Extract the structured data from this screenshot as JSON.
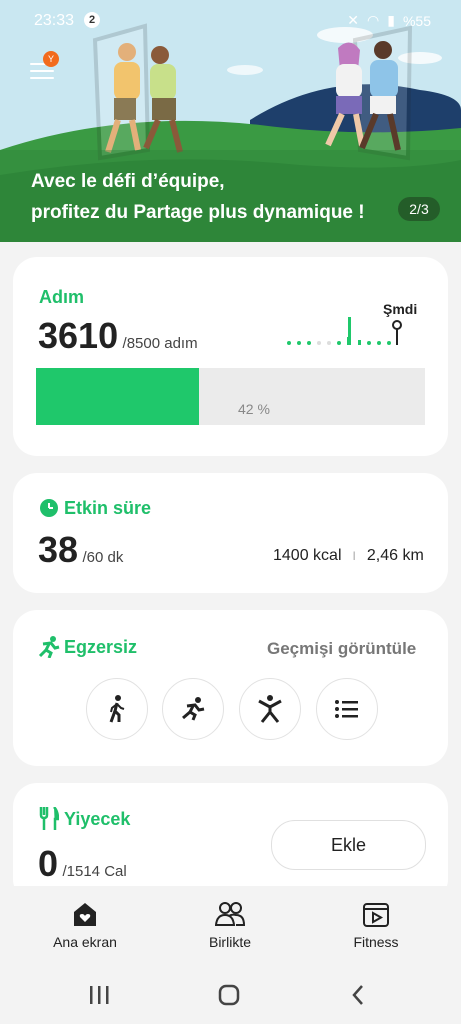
{
  "status_bar": {
    "time": "23:33",
    "notification_count": "2",
    "battery": "%55"
  },
  "banner": {
    "line1": "Avec le défi d’équipe,",
    "line2": "profitez du Partage plus dynamique !",
    "pager": "2/3",
    "menu_badge": "Y"
  },
  "steps": {
    "title": "Adım",
    "value": "3610",
    "goal": "/8500 adım",
    "now_label": "Şmdi",
    "progress": 0.42,
    "progress_text": "42 %"
  },
  "active": {
    "title": "Etkin süre",
    "value": "38",
    "goal": "/60 dk",
    "kcal": "1400 kcal",
    "distance": "2,46 km"
  },
  "exercise": {
    "title": "Egzersiz",
    "history_link": "Geçmişi görüntüle",
    "buttons": [
      "walk-icon",
      "run-icon",
      "workout-icon",
      "list-icon"
    ]
  },
  "food": {
    "title": "Yiyecek",
    "value": "0",
    "goal": "/1514 Cal",
    "add_label": "Ekle"
  },
  "bottom_nav": {
    "home": "Ana ekran",
    "together": "Birlikte",
    "fitness": "Fitness"
  },
  "colors": {
    "accent": "#1fbf6a",
    "banner_sky": "#c7e6f0",
    "banner_grass": "#3a9a43"
  }
}
